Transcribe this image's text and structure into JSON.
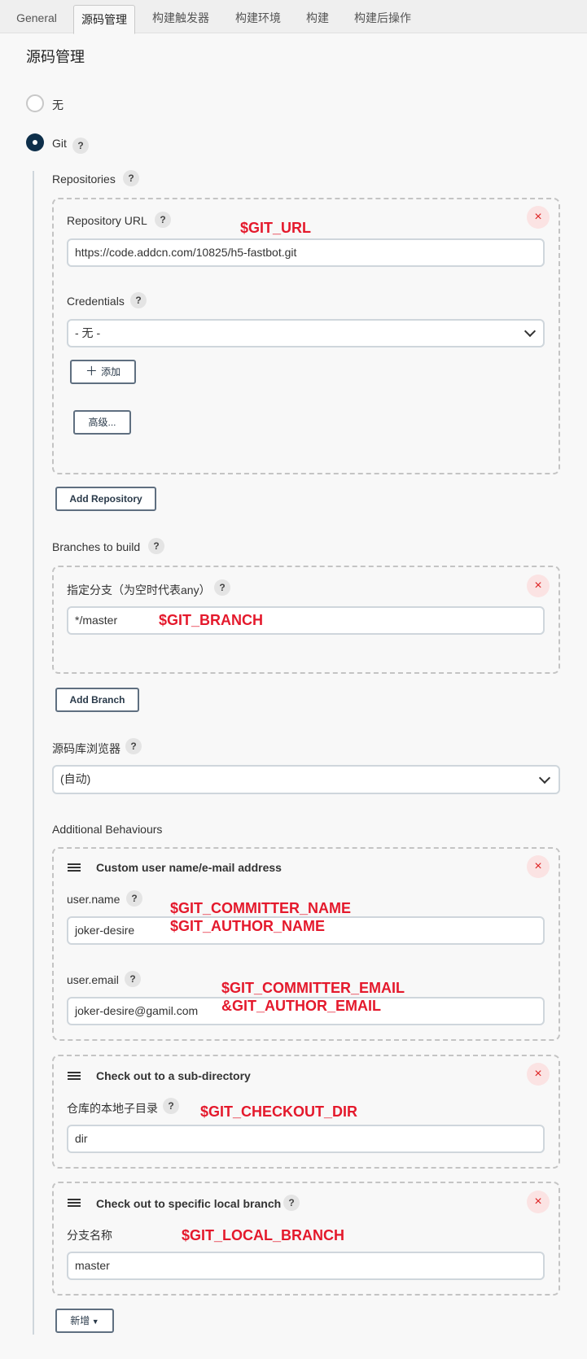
{
  "tabs": [
    "General",
    "源码管理",
    "构建触发器",
    "构建环境",
    "构建",
    "构建后操作"
  ],
  "section_title": "源码管理",
  "scm": {
    "none_label": "无",
    "git_label": "Git"
  },
  "repositories": {
    "label": "Repositories",
    "url_label": "Repository URL",
    "url_value": "https://code.addcn.com/10825/h5-fastbot.git",
    "url_annotation": "$GIT_URL",
    "credentials_label": "Credentials",
    "credentials_value": "- 无 -",
    "add_label": "添加",
    "advanced_label": "高级...",
    "add_repository_label": "Add Repository"
  },
  "branches": {
    "label": "Branches to build",
    "specifier_label": "指定分支（为空时代表any）",
    "specifier_value": "*/master",
    "annotation": "$GIT_BRANCH",
    "add_branch_label": "Add Branch"
  },
  "browser": {
    "label": "源码库浏览器",
    "value": "(自动)"
  },
  "behaviours": {
    "label": "Additional Behaviours",
    "custom_user": {
      "title": "Custom user name/e-mail address",
      "name_label": "user.name",
      "name_value": "joker-desire",
      "name_annotation_1": "$GIT_COMMITTER_NAME",
      "name_annotation_2": "$GIT_AUTHOR_NAME",
      "email_label": "user.email",
      "email_value": "joker-desire@gamil.com",
      "email_annotation_1": "$GIT_COMMITTER_EMAIL",
      "email_annotation_2": "&GIT_AUTHOR_EMAIL"
    },
    "subdir": {
      "title": "Check out to a sub-directory",
      "dir_label": "仓库的本地子目录",
      "dir_value": "dir",
      "annotation": "$GIT_CHECKOUT_DIR"
    },
    "local_branch": {
      "title": "Check out to specific local branch",
      "branch_label": "分支名称",
      "branch_value": "master",
      "annotation": "$GIT_LOCAL_BRANCH"
    },
    "add_label": "新增"
  },
  "common": {
    "help": "?",
    "close": "×"
  },
  "colors": {
    "annotation": "#e4192c",
    "radio_selected": "#0e2f4a",
    "close_bg": "#fbe3e3"
  }
}
